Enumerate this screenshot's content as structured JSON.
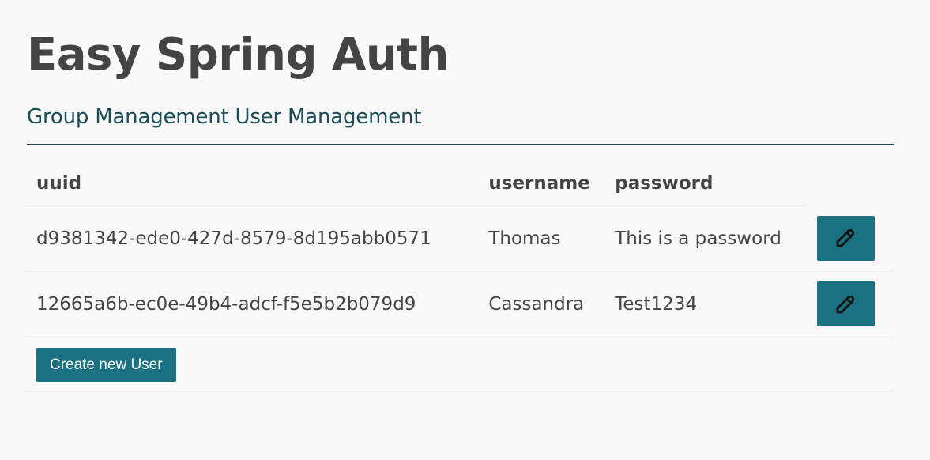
{
  "header": {
    "title": "Easy Spring Auth"
  },
  "nav": {
    "items": [
      {
        "label": "Group Management"
      },
      {
        "label": "User Management"
      }
    ]
  },
  "table": {
    "columns": [
      "uuid",
      "username",
      "password"
    ],
    "rows": [
      {
        "uuid": "d9381342-ede0-427d-8579-8d195abb0571",
        "username": "Thomas",
        "password": "This is a password"
      },
      {
        "uuid": "12665a6b-ec0e-49b4-adcf-f5e5b2b079d9",
        "username": "Cassandra",
        "password": "Test1234"
      }
    ],
    "row_action_icon": "edit-pencil-icon"
  },
  "actions": {
    "create_label": "Create new User"
  },
  "colors": {
    "accent": "#1b7181",
    "nav_text": "#1a4d58",
    "nav_border": "#154a54",
    "text": "#444444",
    "background": "#f9f9f9"
  }
}
